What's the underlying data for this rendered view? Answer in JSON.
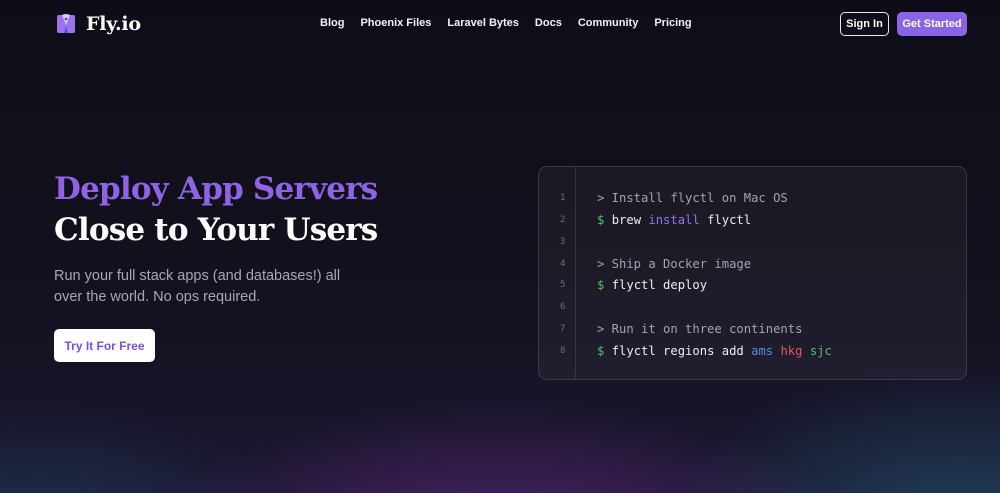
{
  "header": {
    "brand": "Fly.io",
    "nav": [
      "Blog",
      "Phoenix Files",
      "Laravel Bytes",
      "Docs",
      "Community",
      "Pricing"
    ],
    "signin_label": "Sign In",
    "get_started_label": "Get Started"
  },
  "hero": {
    "title_line1": "Deploy App Servers",
    "title_line2": "Close to Your Users",
    "subtitle": "Run your full stack apps (and databases!) all over the world. No ops required.",
    "cta_label": "Try It For Free"
  },
  "code": {
    "lines": [
      {
        "n": "1",
        "tokens": [
          {
            "t": "> Install flyctl on Mac OS",
            "c": "comment"
          }
        ]
      },
      {
        "n": "2",
        "tokens": [
          {
            "t": "$ ",
            "c": "prompt"
          },
          {
            "t": "brew ",
            "c": "plain"
          },
          {
            "t": "install",
            "c": "purple"
          },
          {
            "t": " flyctl",
            "c": "plain"
          }
        ]
      },
      {
        "n": "3",
        "tokens": []
      },
      {
        "n": "4",
        "tokens": [
          {
            "t": "> Ship a Docker image",
            "c": "comment"
          }
        ]
      },
      {
        "n": "5",
        "tokens": [
          {
            "t": "$ ",
            "c": "prompt"
          },
          {
            "t": "flyctl deploy",
            "c": "plain"
          }
        ]
      },
      {
        "n": "6",
        "tokens": []
      },
      {
        "n": "7",
        "tokens": [
          {
            "t": "> Run it on three continents",
            "c": "comment"
          }
        ]
      },
      {
        "n": "8",
        "tokens": [
          {
            "t": "$ ",
            "c": "prompt"
          },
          {
            "t": "flyctl regions add ",
            "c": "plain"
          },
          {
            "t": "ams",
            "c": "blue"
          },
          {
            "t": " ",
            "c": "plain"
          },
          {
            "t": "hkg",
            "c": "red"
          },
          {
            "t": " ",
            "c": "plain"
          },
          {
            "t": "sjc",
            "c": "green"
          }
        ]
      }
    ]
  },
  "colors": {
    "accent_purple": "#8a63e8",
    "title_purple": "#8f63e6",
    "background": "#0e0d17"
  },
  "icons": [
    "fly-balloon-logo-icon"
  ]
}
